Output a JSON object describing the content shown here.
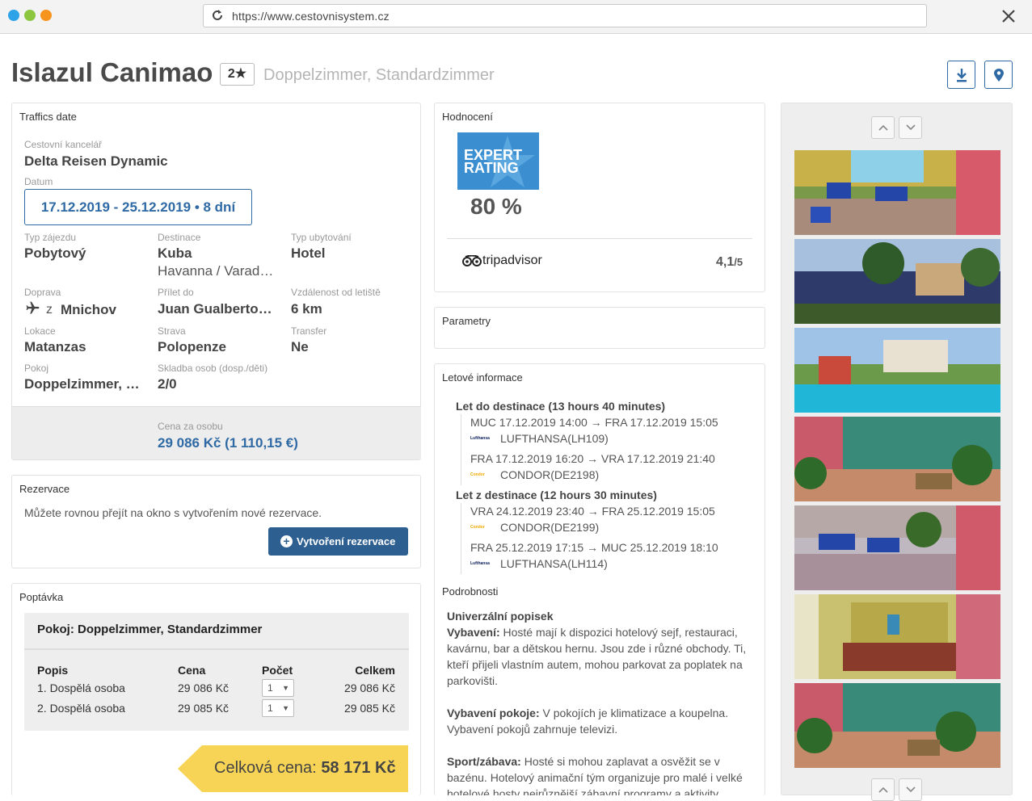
{
  "browser": {
    "url": "https://www.cestovnisystem.cz"
  },
  "header": {
    "title": "Islazul Canimao",
    "stars": "2★",
    "subtitle": "Doppelzimmer, Standardzimmer"
  },
  "traffics": {
    "heading": "Traffics date",
    "agency_label": "Cestovní kancelář",
    "agency": "Delta Reisen Dynamic",
    "date_label": "Datum",
    "date": "17.12.2019 - 25.12.2019 • 8 dní",
    "trip_type_label": "Typ zájezdu",
    "trip_type": "Pobytový",
    "dest_label": "Destinace",
    "dest": "Kuba",
    "dest_sub": "Havanna / Varad…",
    "accom_label": "Typ ubytování",
    "accom": "Hotel",
    "transport_label": "Doprava",
    "transport_prefix": "z",
    "transport": "Mnichov",
    "arrival_label": "Přílet do",
    "arrival": "Juan Gualberto…",
    "distance_label": "Vzdálenost od letiště",
    "distance": "6 km",
    "location_label": "Lokace",
    "location": "Matanzas",
    "board_label": "Strava",
    "board": "Polopenze",
    "transfer_label": "Transfer",
    "transfer": "Ne",
    "room_label": "Pokoj",
    "room": "Doppelzimmer, …",
    "persons_label": "Skladba osob (dosp./děti)",
    "persons": "2/0",
    "price_label": "Cena za osobu",
    "price": "29 086 Kč (1 110,15 €)"
  },
  "reservation": {
    "heading": "Rezervace",
    "text": "Můžete rovnou přejít na okno s vytvořením nové rezervace.",
    "button": "Vytvoření rezervace"
  },
  "inquiry": {
    "heading": "Poptávka",
    "room_title": "Pokoj: Doppelzimmer, Standardzimmer",
    "columns": [
      "Popis",
      "Cena",
      "Počet",
      "Celkem"
    ],
    "rows": [
      {
        "desc": "1. Dospělá osoba",
        "price": "29 086 Kč",
        "qty": "1",
        "total": "29 086 Kč"
      },
      {
        "desc": "2. Dospělá osoba",
        "price": "29 085 Kč",
        "qty": "1",
        "total": "29 085 Kč"
      }
    ],
    "total_label": "Celková cena:",
    "total_value": "58 171 Kč"
  },
  "rating": {
    "heading": "Hodnocení",
    "badge_line1": "EXPERT",
    "badge_line2": "RATING",
    "percent": "80 %",
    "tripadvisor_name": "tripadvisor",
    "tripadvisor_score": "4,1",
    "tripadvisor_max": "/5",
    "badge_color": "#3b8fd1"
  },
  "params": {
    "heading": "Parametry"
  },
  "flights": {
    "heading": "Letové informace",
    "outbound_title": "Let do destinace (13 hours 40 minutes)",
    "return_title": "Let z destinace (12 hours 30 minutes)",
    "outbound": [
      {
        "route": "MUC 17.12.2019 14:00 → FRA 17.12.2019 15:05",
        "logo": "Lufthansa",
        "airline": "LUFTHANSA(LH109)"
      },
      {
        "route": "FRA 17.12.2019 16:20 → VRA 17.12.2019 21:40",
        "logo": "Condor",
        "airline": "CONDOR(DE2198)"
      }
    ],
    "return": [
      {
        "route": "VRA 24.12.2019 23:40 → FRA 25.12.2019 15:05",
        "logo": "Condor",
        "airline": "CONDOR(DE2199)"
      },
      {
        "route": "FRA 25.12.2019 17:15 → MUC 25.12.2019 18:10",
        "logo": "Lufthansa",
        "airline": "LUFTHANSA(LH114)"
      }
    ]
  },
  "details": {
    "heading": "Podrobnosti",
    "universal": "Univerzální popisek",
    "equip_label": "Vybavení:",
    "equip_text": "Hosté mají k dispozici hotelový sejf, restauraci, kavárnu, bar a dětskou hernu. Jsou zde i různé obchody. Ti, kteří přijeli vlastním autem, mohou parkovat za poplatek na parkovišti.",
    "room_equip_label": "Vybavení pokoje:",
    "room_equip_text": "V pokojích je klimatizace a koupelna. Vybavení pokojů zahrnuje televizi.",
    "sport_label": "Sport/zábava:",
    "sport_text": "Hosté si mohou zaplavat a osvěžit se v bazénu. Hotelový animační tým organizuje pro malé i velké hotelové hosty nejrůznější zábavní programy a aktivity."
  },
  "colors": {
    "accent": "#2f6aa5",
    "button": "#2e5f91",
    "total_tag": "#f7d455"
  }
}
